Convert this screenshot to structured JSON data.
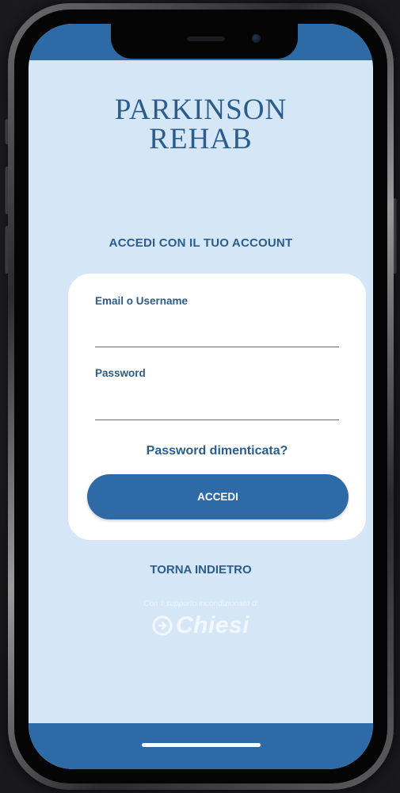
{
  "app": {
    "logo_line1": "PARKINSON",
    "logo_line2": "REHAB"
  },
  "login": {
    "section_title": "ACCEDI CON IL TUO ACCOUNT",
    "email_label": "Email o Username",
    "email_value": "",
    "password_label": "Password",
    "password_value": "",
    "forgot_label": "Password dimenticata?",
    "submit_label": "ACCEDI",
    "back_label": "TORNA INDIETRO"
  },
  "sponsor": {
    "caption": "Con il supporto incondizionato di",
    "brand": "Chiesi"
  },
  "colors": {
    "primary": "#2d6aa6",
    "text_primary": "#2b5c8e",
    "background": "#d5e7f6",
    "card": "#ffffff"
  },
  "icons": {
    "sponsor_mark": "chiesi-logo-icon"
  }
}
